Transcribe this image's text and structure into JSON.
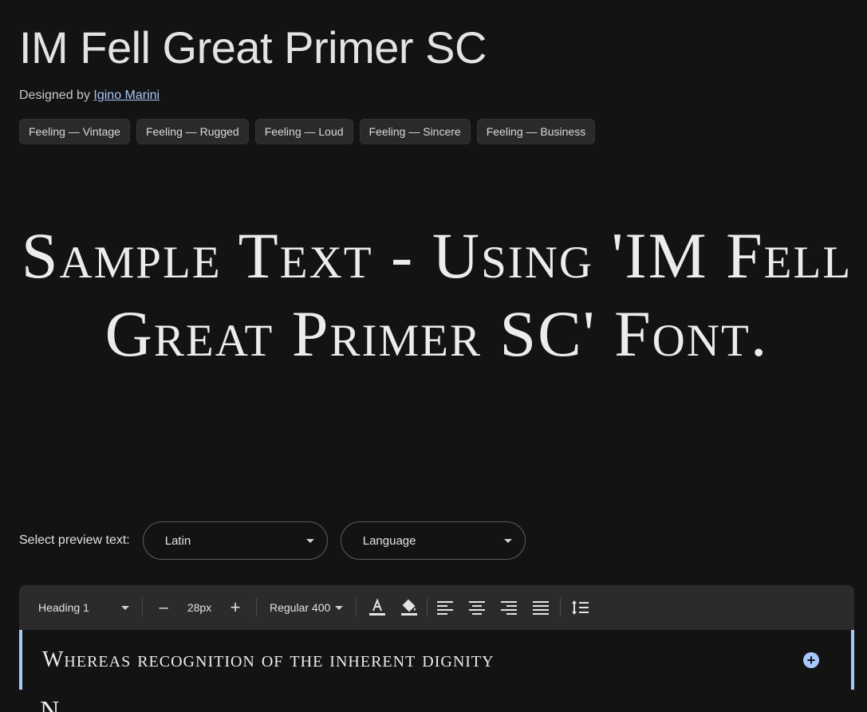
{
  "header": {
    "font_name": "IM Fell Great Primer SC",
    "designed_by_prefix": "Designed by",
    "designer_name": "Igino Marini"
  },
  "tags": [
    {
      "label": "Feeling — Vintage"
    },
    {
      "label": "Feeling — Rugged"
    },
    {
      "label": "Feeling — Loud"
    },
    {
      "label": "Feeling — Sincere"
    },
    {
      "label": "Feeling — Business"
    }
  ],
  "sample": {
    "text": "Sample Text - Using 'IM Fell Great Primer SC' Font."
  },
  "preview": {
    "label": "Select preview text:",
    "script_select": "Latin",
    "language_select": "Language"
  },
  "toolbar": {
    "style_select": "Heading 1",
    "decrease_label": "–",
    "font_size": "28px",
    "increase_label": "+",
    "weight_select": "Regular 400",
    "icons": [
      "text-color-icon",
      "highlight-color-icon",
      "align-left-icon",
      "align-center-icon",
      "align-right-icon",
      "align-justify-icon",
      "line-height-icon"
    ]
  },
  "editor": {
    "line_1": "Whereas recognition of the inherent dignity",
    "line_2_partial": "N",
    "add_icon_label": "+"
  },
  "colors": {
    "background": "#131313",
    "accent": "#a8c7fa",
    "toolbar_bg": "#2b2b2b",
    "tag_bg": "#2a2a2a"
  }
}
